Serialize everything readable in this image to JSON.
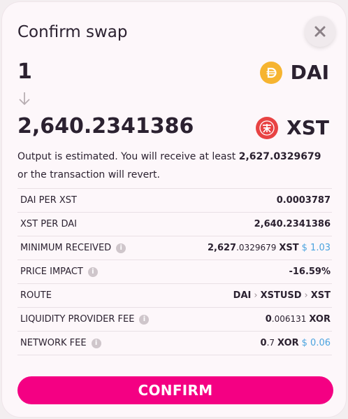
{
  "dialog": {
    "title": "Confirm swap",
    "from": {
      "amount": "1",
      "symbol": "DAI"
    },
    "to": {
      "amount": "2,640.2341386",
      "symbol": "XST"
    },
    "note": {
      "prefix": "Output is estimated. You will receive at least",
      "min_amount": "2,627.0329679",
      "suffix": "or the transaction will revert."
    },
    "rows": [
      {
        "label": "DAI PER XST",
        "value": "0.0003787"
      },
      {
        "label": "XST PER DAI",
        "value": "2,640.2341386"
      },
      {
        "label": "MINIMUM RECEIVED",
        "value_main": "2,627",
        "value_fraction": ".0329679",
        "token": "XST",
        "usd": "$ 1.03"
      },
      {
        "label": "PRICE IMPACT",
        "value": "-16.59%"
      },
      {
        "label": "ROUTE",
        "route": [
          "DAI",
          "XSTUSD",
          "XST"
        ]
      },
      {
        "label": "LIQUIDITY PROVIDER FEE",
        "value_main": "0",
        "value_fraction": ".006131",
        "token": "XOR"
      },
      {
        "label": "NETWORK FEE",
        "value_main": "0",
        "value_fraction": ".7",
        "token": "XOR",
        "usd": "$ 0.06"
      }
    ],
    "confirm_label": "CONFIRM"
  },
  "colors": {
    "accent": "#f40083",
    "negative": "#f1147f",
    "usd": "#4aa3df",
    "dai": "#f6b430",
    "xst": "#e84343"
  },
  "icons": {
    "close": "close-icon",
    "arrow": "arrow-down-icon",
    "dai": "dai-token-icon",
    "xst": "xst-token-icon",
    "info": "info-icon"
  }
}
